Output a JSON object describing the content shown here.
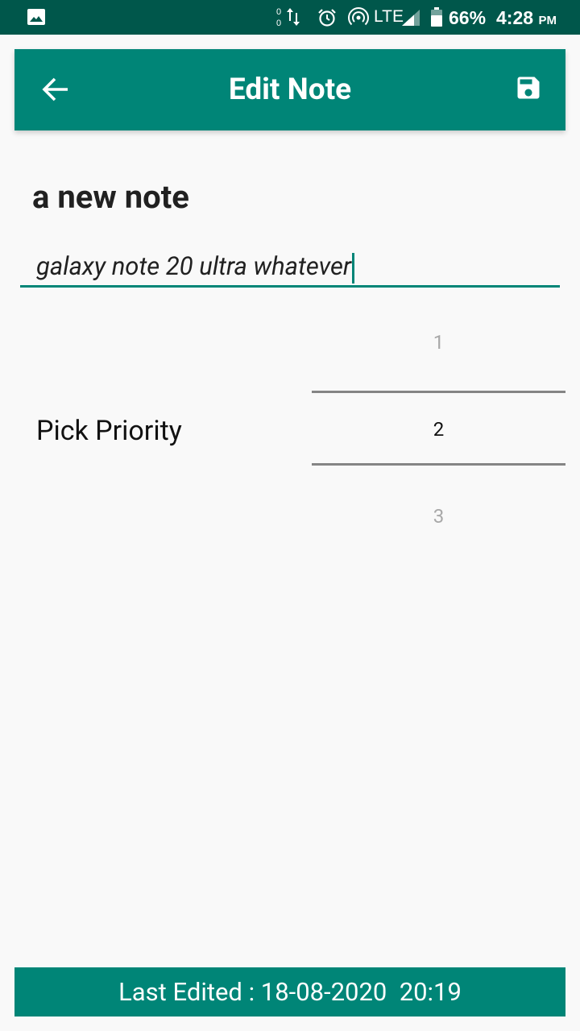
{
  "status_bar": {
    "network": "LTE",
    "battery": "66%",
    "time": "4:28",
    "ampm": "PM",
    "icons": [
      "gallery-icon",
      "data-activity-icon",
      "alarm-icon",
      "hotspot-icon",
      "signal-icon",
      "battery-icon"
    ]
  },
  "app_bar": {
    "title": "Edit Note",
    "back_icon": "arrow-back-icon",
    "save_icon": "save-icon"
  },
  "note": {
    "title": "a new note",
    "description": "galaxy note 20 ultra whatever"
  },
  "priority": {
    "label": "Pick Priority",
    "options": [
      "1",
      "2",
      "3"
    ],
    "selected": "2"
  },
  "footer": {
    "text": "Last Edited : 18-08-2020  20:19"
  },
  "colors": {
    "status_bar": "#00574b",
    "primary": "#008577",
    "background": "#f9f9f9"
  }
}
